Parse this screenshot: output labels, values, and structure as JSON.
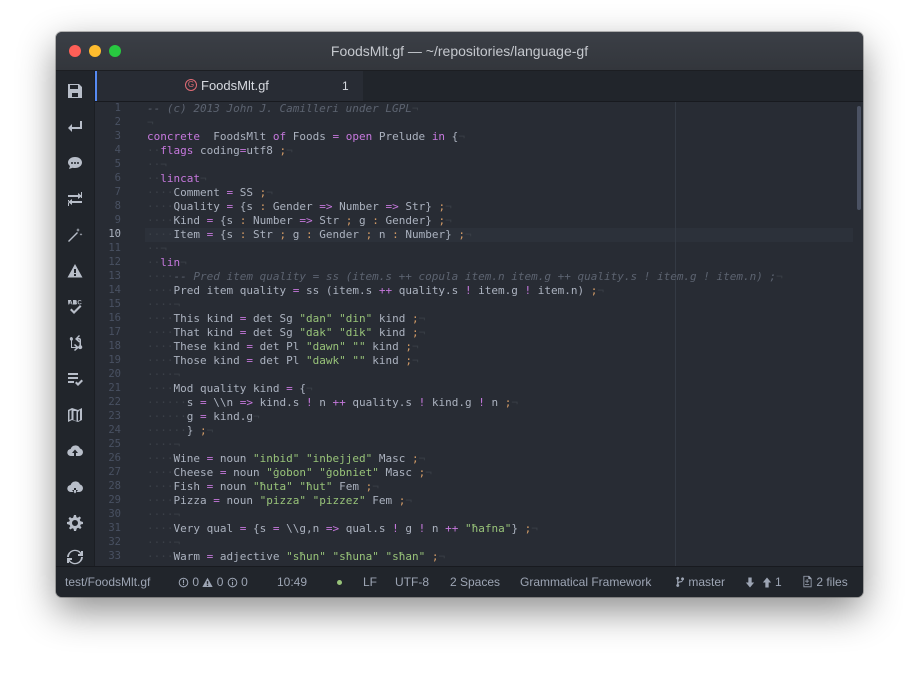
{
  "window": {
    "title": "FoodsMlt.gf — ~/repositories/language-gf"
  },
  "tab": {
    "label": "FoodsMlt.gf",
    "count": "1"
  },
  "toolbar": {
    "icons": [
      "save-icon",
      "return-icon",
      "comment-icon",
      "indent-icon",
      "magic-wand-icon",
      "warning-icon",
      "spellcheck-icon",
      "git-sync-icon",
      "checklist-icon",
      "map-icon",
      "cloud-upload-icon",
      "cloud-download-icon",
      "gear-icon",
      "refresh-icon"
    ]
  },
  "editor": {
    "current_line": 10,
    "lines": [
      {
        "n": "1",
        "tokens": [
          [
            "cm",
            "-- (c) 2013 John J. Camilleri under LGPL"
          ],
          [
            "ws",
            "¬"
          ]
        ]
      },
      {
        "n": "2",
        "tokens": [
          [
            "ws",
            "¬"
          ]
        ]
      },
      {
        "n": "3",
        "tokens": [
          [
            "kw",
            "concrete"
          ],
          [
            "",
            "  FoodsMlt "
          ],
          [
            "kw",
            "of"
          ],
          [
            "",
            " Foods "
          ],
          [
            "op",
            "="
          ],
          [
            "",
            ""
          ],
          [
            "",
            " "
          ],
          [
            "kw",
            "open"
          ],
          [
            "",
            " Prelude "
          ],
          [
            "kw",
            "in"
          ],
          [
            "",
            " {"
          ],
          [
            "ws",
            "¬"
          ]
        ]
      },
      {
        "n": "4",
        "tokens": [
          [
            "ws",
            "··"
          ],
          [
            "kw",
            "flags"
          ],
          [
            "",
            " coding"
          ],
          [
            "op",
            "="
          ],
          [
            "",
            "utf8 "
          ],
          [
            "pn",
            ";"
          ],
          [
            "ws",
            "¬"
          ]
        ]
      },
      {
        "n": "5",
        "tokens": [
          [
            "ws",
            "··¬"
          ]
        ]
      },
      {
        "n": "6",
        "tokens": [
          [
            "ws",
            "··"
          ],
          [
            "kw",
            "lincat"
          ],
          [
            "ws",
            "¬"
          ]
        ]
      },
      {
        "n": "7",
        "tokens": [
          [
            "ws",
            "····"
          ],
          [
            "",
            "Comment "
          ],
          [
            "op",
            "="
          ],
          [
            "",
            " SS "
          ],
          [
            "pn",
            ";"
          ],
          [
            "ws",
            "¬"
          ]
        ]
      },
      {
        "n": "8",
        "tokens": [
          [
            "ws",
            "····"
          ],
          [
            "",
            "Quality "
          ],
          [
            "op",
            "="
          ],
          [
            "",
            " {s "
          ],
          [
            "pn",
            ":"
          ],
          [
            "",
            " Gender "
          ],
          [
            "op",
            "=>"
          ],
          [
            "",
            " Number "
          ],
          [
            "op",
            "=>"
          ],
          [
            "",
            " Str} "
          ],
          [
            "pn",
            ";"
          ],
          [
            "ws",
            "¬"
          ]
        ]
      },
      {
        "n": "9",
        "tokens": [
          [
            "ws",
            "····"
          ],
          [
            "",
            "Kind "
          ],
          [
            "op",
            "="
          ],
          [
            "",
            " {s "
          ],
          [
            "pn",
            ":"
          ],
          [
            "",
            " Number "
          ],
          [
            "op",
            "=>"
          ],
          [
            "",
            " Str "
          ],
          [
            "pn",
            ";"
          ],
          [
            "",
            " g "
          ],
          [
            "pn",
            ":"
          ],
          [
            "",
            " Gender} "
          ],
          [
            "pn",
            ";"
          ],
          [
            "ws",
            "¬"
          ]
        ]
      },
      {
        "n": "10",
        "tokens": [
          [
            "ws",
            "····"
          ],
          [
            "",
            "Item "
          ],
          [
            "op",
            "="
          ],
          [
            "",
            " {s "
          ],
          [
            "pn",
            ":"
          ],
          [
            "",
            " Str "
          ],
          [
            "pn",
            ";"
          ],
          [
            "",
            " g "
          ],
          [
            "pn",
            ":"
          ],
          [
            "",
            " Gender "
          ],
          [
            "pn",
            ";"
          ],
          [
            "",
            " n "
          ],
          [
            "pn",
            ":"
          ],
          [
            "",
            " Number} "
          ],
          [
            "pn",
            ";"
          ],
          [
            "ws",
            "¬"
          ]
        ]
      },
      {
        "n": "11",
        "tokens": [
          [
            "ws",
            "··¬"
          ]
        ]
      },
      {
        "n": "12",
        "tokens": [
          [
            "ws",
            "··"
          ],
          [
            "kw",
            "lin"
          ],
          [
            "ws",
            "¬"
          ]
        ]
      },
      {
        "n": "13",
        "tokens": [
          [
            "ws",
            "····"
          ],
          [
            "cm",
            "-- Pred item quality = ss (item.s ++ copula item.n item.g ++ quality.s ! item.g ! item.n) ;"
          ],
          [
            "ws",
            "¬"
          ]
        ]
      },
      {
        "n": "14",
        "tokens": [
          [
            "ws",
            "····"
          ],
          [
            "",
            "Pred item quality "
          ],
          [
            "op",
            "="
          ],
          [
            "",
            " ss (item.s "
          ],
          [
            "op",
            "++"
          ],
          [
            "",
            " quality.s "
          ],
          [
            "op",
            "!"
          ],
          [
            "",
            " item.g "
          ],
          [
            "op",
            "!"
          ],
          [
            "",
            " item.n) "
          ],
          [
            "pn",
            ";"
          ],
          [
            "ws",
            "¬"
          ]
        ]
      },
      {
        "n": "15",
        "tokens": [
          [
            "ws",
            "····¬"
          ]
        ]
      },
      {
        "n": "16",
        "tokens": [
          [
            "ws",
            "····"
          ],
          [
            "",
            "This kind "
          ],
          [
            "op",
            "="
          ],
          [
            "",
            " det Sg "
          ],
          [
            "st",
            "\"dan\""
          ],
          [
            "",
            " "
          ],
          [
            "st",
            "\"din\""
          ],
          [
            "",
            " kind "
          ],
          [
            "pn",
            ";"
          ],
          [
            "ws",
            "¬"
          ]
        ]
      },
      {
        "n": "17",
        "tokens": [
          [
            "ws",
            "····"
          ],
          [
            "",
            "That kind "
          ],
          [
            "op",
            "="
          ],
          [
            "",
            " det Sg "
          ],
          [
            "st",
            "\"dak\""
          ],
          [
            "",
            " "
          ],
          [
            "st",
            "\"dik\""
          ],
          [
            "",
            " kind "
          ],
          [
            "pn",
            ";"
          ],
          [
            "ws",
            "¬"
          ]
        ]
      },
      {
        "n": "18",
        "tokens": [
          [
            "ws",
            "····"
          ],
          [
            "",
            "These kind "
          ],
          [
            "op",
            "="
          ],
          [
            "",
            " det Pl "
          ],
          [
            "st",
            "\"dawn\""
          ],
          [
            "",
            " "
          ],
          [
            "st",
            "\"\""
          ],
          [
            "",
            " kind "
          ],
          [
            "pn",
            ";"
          ],
          [
            "ws",
            "¬"
          ]
        ]
      },
      {
        "n": "19",
        "tokens": [
          [
            "ws",
            "····"
          ],
          [
            "",
            "Those kind "
          ],
          [
            "op",
            "="
          ],
          [
            "",
            " det Pl "
          ],
          [
            "st",
            "\"dawk\""
          ],
          [
            "",
            " "
          ],
          [
            "st",
            "\"\""
          ],
          [
            "",
            " kind "
          ],
          [
            "pn",
            ";"
          ],
          [
            "ws",
            "¬"
          ]
        ]
      },
      {
        "n": "20",
        "tokens": [
          [
            "ws",
            "····¬"
          ]
        ]
      },
      {
        "n": "21",
        "tokens": [
          [
            "ws",
            "····"
          ],
          [
            "",
            "Mod quality kind "
          ],
          [
            "op",
            "="
          ],
          [
            "",
            " {"
          ],
          [
            "ws",
            "¬"
          ]
        ]
      },
      {
        "n": "22",
        "tokens": [
          [
            "ws",
            "······"
          ],
          [
            "",
            "s "
          ],
          [
            "op",
            "="
          ],
          [
            "",
            " \\\\n "
          ],
          [
            "op",
            "=>"
          ],
          [
            "",
            " kind.s "
          ],
          [
            "op",
            "!"
          ],
          [
            "",
            " n "
          ],
          [
            "op",
            "++"
          ],
          [
            "",
            " quality.s "
          ],
          [
            "op",
            "!"
          ],
          [
            "",
            " kind.g "
          ],
          [
            "op",
            "!"
          ],
          [
            "",
            " n "
          ],
          [
            "pn",
            ";"
          ],
          [
            "ws",
            "¬"
          ]
        ]
      },
      {
        "n": "23",
        "tokens": [
          [
            "ws",
            "······"
          ],
          [
            "",
            "g "
          ],
          [
            "op",
            "="
          ],
          [
            "",
            " kind.g"
          ],
          [
            "ws",
            "¬"
          ]
        ]
      },
      {
        "n": "24",
        "tokens": [
          [
            "ws",
            "······"
          ],
          [
            "",
            "} "
          ],
          [
            "pn",
            ";"
          ],
          [
            "ws",
            "¬"
          ]
        ]
      },
      {
        "n": "25",
        "tokens": [
          [
            "ws",
            "····¬"
          ]
        ]
      },
      {
        "n": "26",
        "tokens": [
          [
            "ws",
            "····"
          ],
          [
            "",
            "Wine "
          ],
          [
            "op",
            "="
          ],
          [
            "",
            " noun "
          ],
          [
            "st",
            "\"inbid\""
          ],
          [
            "",
            " "
          ],
          [
            "st",
            "\"inbejjed\""
          ],
          [
            "",
            " Masc "
          ],
          [
            "pn",
            ";"
          ],
          [
            "ws",
            "¬"
          ]
        ]
      },
      {
        "n": "27",
        "tokens": [
          [
            "ws",
            "····"
          ],
          [
            "",
            "Cheese "
          ],
          [
            "op",
            "="
          ],
          [
            "",
            " noun "
          ],
          [
            "st",
            "\"ġobon\""
          ],
          [
            "",
            " "
          ],
          [
            "st",
            "\"ġobniet\""
          ],
          [
            "",
            " Masc "
          ],
          [
            "pn",
            ";"
          ],
          [
            "ws",
            "¬"
          ]
        ]
      },
      {
        "n": "28",
        "tokens": [
          [
            "ws",
            "····"
          ],
          [
            "",
            "Fish "
          ],
          [
            "op",
            "="
          ],
          [
            "",
            " noun "
          ],
          [
            "st",
            "\"ħuta\""
          ],
          [
            "",
            " "
          ],
          [
            "st",
            "\"ħut\""
          ],
          [
            "",
            " Fem "
          ],
          [
            "pn",
            ";"
          ],
          [
            "ws",
            "¬"
          ]
        ]
      },
      {
        "n": "29",
        "tokens": [
          [
            "ws",
            "····"
          ],
          [
            "",
            "Pizza "
          ],
          [
            "op",
            "="
          ],
          [
            "",
            " noun "
          ],
          [
            "st",
            "\"pizza\""
          ],
          [
            "",
            " "
          ],
          [
            "st",
            "\"pizzez\""
          ],
          [
            "",
            " Fem "
          ],
          [
            "pn",
            ";"
          ],
          [
            "ws",
            "¬"
          ]
        ]
      },
      {
        "n": "30",
        "tokens": [
          [
            "ws",
            "····¬"
          ]
        ]
      },
      {
        "n": "31",
        "tokens": [
          [
            "ws",
            "····"
          ],
          [
            "",
            "Very qual "
          ],
          [
            "op",
            "="
          ],
          [
            "",
            " {s "
          ],
          [
            "op",
            "="
          ],
          [
            "",
            " \\\\g,n "
          ],
          [
            "op",
            "=>"
          ],
          [
            "",
            " qual.s "
          ],
          [
            "op",
            "!"
          ],
          [
            "",
            " g "
          ],
          [
            "op",
            "!"
          ],
          [
            "",
            " n "
          ],
          [
            "op",
            "++"
          ],
          [
            "",
            " "
          ],
          [
            "st",
            "\"ħafna\""
          ],
          [
            "",
            "} "
          ],
          [
            "pn",
            ";"
          ],
          [
            "ws",
            "¬"
          ]
        ]
      },
      {
        "n": "32",
        "tokens": [
          [
            "ws",
            "····¬"
          ]
        ]
      },
      {
        "n": "33",
        "tokens": [
          [
            "ws",
            "····"
          ],
          [
            "",
            "Warm "
          ],
          [
            "op",
            "="
          ],
          [
            "",
            " adjective "
          ],
          [
            "st",
            "\"sħun\""
          ],
          [
            "",
            " "
          ],
          [
            "st",
            "\"sħuna\""
          ],
          [
            "",
            " "
          ],
          [
            "st",
            "\"sħan\""
          ],
          [
            "",
            " "
          ],
          [
            "pn",
            ";"
          ],
          [
            "ws",
            "¬"
          ]
        ]
      }
    ]
  },
  "statusbar": {
    "path": "test/FoodsMlt.gf",
    "errors": "0",
    "warnings": "0",
    "infos": "0",
    "cursor": "10:49",
    "line_ending": "LF",
    "encoding": "UTF-8",
    "indent": "2 Spaces",
    "grammar": "Grammatical Framework",
    "branch": "master",
    "ahead": "1",
    "files": "2 files"
  },
  "colors": {
    "keyword": "#c678dd",
    "string": "#98c379",
    "punct": "#d19a66",
    "comment": "#5c6370",
    "text": "#abb2bf"
  }
}
